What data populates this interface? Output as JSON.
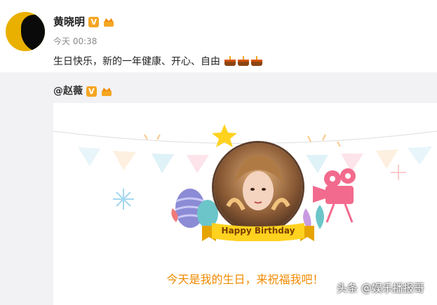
{
  "post": {
    "author": "黄晓明",
    "verified_badge": "V",
    "time": "今天 00:38",
    "text": "生日快乐，新的一年健康、开心、自由",
    "cake_icons": 3
  },
  "repost": {
    "mention": "@赵薇",
    "verified_badge": "V",
    "card": {
      "banner_label": "Happy Birthday",
      "caption": "今天是我的生日，来祝福我吧！"
    }
  },
  "watermark": "头条 @娱乐播报哥",
  "colors": {
    "gold": "#f5a623",
    "orange_text": "#f08a00",
    "bg_gray": "#f2f2f5"
  }
}
